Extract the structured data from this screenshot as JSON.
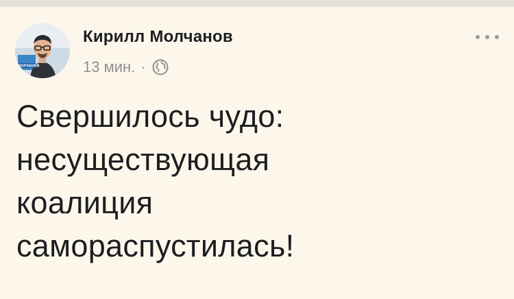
{
  "post": {
    "author_name": "Кирилл Молчанов",
    "timestamp": "13 мин.",
    "separator": "·",
    "audience_icon": "globe-icon",
    "menu_icon": "more-options-icon",
    "avatar_caption": "МОЛЧАНОВ",
    "text": "Свершилось чудо:\nнесуществующая\nкоалиция\nсамораспустилась!"
  },
  "colors": {
    "background": "#fdf7eb",
    "text": "#1c1e21",
    "meta": "#8e8e8e"
  }
}
